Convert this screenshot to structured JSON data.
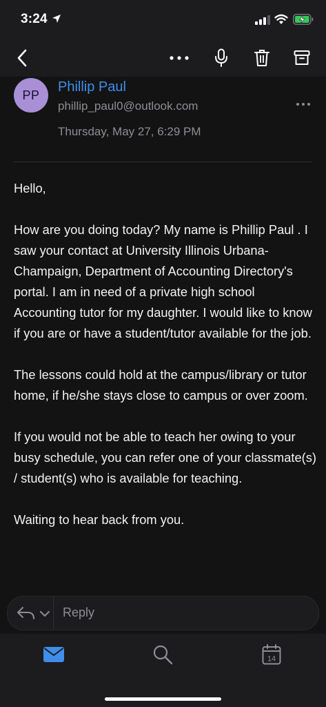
{
  "status_bar": {
    "time": "3:24"
  },
  "nav_bar": {
    "back_icon": "chevron-left-icon",
    "more_icon": "ellipsis-icon",
    "mic_icon": "microphone-icon",
    "trash_icon": "trash-icon",
    "archive_icon": "archive-icon"
  },
  "message": {
    "avatar_initials": "PP",
    "sender_name": "Phillip Paul",
    "sender_email": "phillip_paul0@outlook.com",
    "date": "Thursday, May 27, 6:29 PM",
    "paragraphs": [
      "Hello,",
      "How are you doing today? My name is Phillip Paul . I saw your contact at University Illinois Urbana- Champaign, Department of Accounting Directory's portal. I am in need of a private high school Accounting tutor for my daughter. I would like to know if you are or have a student/tutor available for the job.",
      "The lessons could hold at the campus/library or tutor home, if he/she stays close to campus or over zoom.",
      "If you would not be able to teach her owing to your busy schedule, you can refer one of your classmate(s) / student(s) who is available for teaching.",
      "Waiting to hear back from you."
    ]
  },
  "reply_bar": {
    "label": "Reply"
  },
  "tab_bar": {
    "calendar_day": "14"
  },
  "colors": {
    "accent": "#3f8fea",
    "avatar_bg": "#a98fd6",
    "background": "#131313"
  }
}
